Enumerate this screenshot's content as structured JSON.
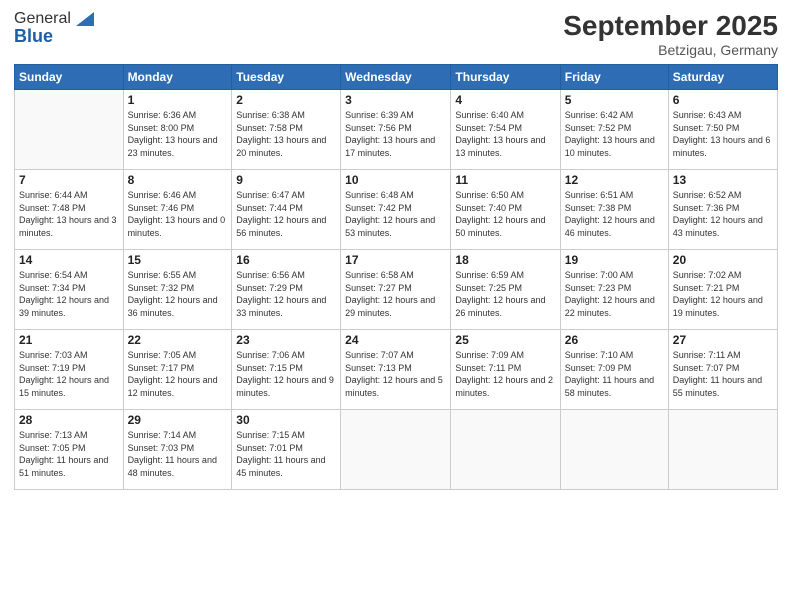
{
  "logo": {
    "general": "General",
    "blue": "Blue"
  },
  "header": {
    "month": "September 2025",
    "location": "Betzigau, Germany"
  },
  "weekdays": [
    "Sunday",
    "Monday",
    "Tuesday",
    "Wednesday",
    "Thursday",
    "Friday",
    "Saturday"
  ],
  "weeks": [
    [
      {
        "day": "",
        "sunrise": "",
        "sunset": "",
        "daylight": ""
      },
      {
        "day": "1",
        "sunrise": "Sunrise: 6:36 AM",
        "sunset": "Sunset: 8:00 PM",
        "daylight": "Daylight: 13 hours and 23 minutes."
      },
      {
        "day": "2",
        "sunrise": "Sunrise: 6:38 AM",
        "sunset": "Sunset: 7:58 PM",
        "daylight": "Daylight: 13 hours and 20 minutes."
      },
      {
        "day": "3",
        "sunrise": "Sunrise: 6:39 AM",
        "sunset": "Sunset: 7:56 PM",
        "daylight": "Daylight: 13 hours and 17 minutes."
      },
      {
        "day": "4",
        "sunrise": "Sunrise: 6:40 AM",
        "sunset": "Sunset: 7:54 PM",
        "daylight": "Daylight: 13 hours and 13 minutes."
      },
      {
        "day": "5",
        "sunrise": "Sunrise: 6:42 AM",
        "sunset": "Sunset: 7:52 PM",
        "daylight": "Daylight: 13 hours and 10 minutes."
      },
      {
        "day": "6",
        "sunrise": "Sunrise: 6:43 AM",
        "sunset": "Sunset: 7:50 PM",
        "daylight": "Daylight: 13 hours and 6 minutes."
      }
    ],
    [
      {
        "day": "7",
        "sunrise": "Sunrise: 6:44 AM",
        "sunset": "Sunset: 7:48 PM",
        "daylight": "Daylight: 13 hours and 3 minutes."
      },
      {
        "day": "8",
        "sunrise": "Sunrise: 6:46 AM",
        "sunset": "Sunset: 7:46 PM",
        "daylight": "Daylight: 13 hours and 0 minutes."
      },
      {
        "day": "9",
        "sunrise": "Sunrise: 6:47 AM",
        "sunset": "Sunset: 7:44 PM",
        "daylight": "Daylight: 12 hours and 56 minutes."
      },
      {
        "day": "10",
        "sunrise": "Sunrise: 6:48 AM",
        "sunset": "Sunset: 7:42 PM",
        "daylight": "Daylight: 12 hours and 53 minutes."
      },
      {
        "day": "11",
        "sunrise": "Sunrise: 6:50 AM",
        "sunset": "Sunset: 7:40 PM",
        "daylight": "Daylight: 12 hours and 50 minutes."
      },
      {
        "day": "12",
        "sunrise": "Sunrise: 6:51 AM",
        "sunset": "Sunset: 7:38 PM",
        "daylight": "Daylight: 12 hours and 46 minutes."
      },
      {
        "day": "13",
        "sunrise": "Sunrise: 6:52 AM",
        "sunset": "Sunset: 7:36 PM",
        "daylight": "Daylight: 12 hours and 43 minutes."
      }
    ],
    [
      {
        "day": "14",
        "sunrise": "Sunrise: 6:54 AM",
        "sunset": "Sunset: 7:34 PM",
        "daylight": "Daylight: 12 hours and 39 minutes."
      },
      {
        "day": "15",
        "sunrise": "Sunrise: 6:55 AM",
        "sunset": "Sunset: 7:32 PM",
        "daylight": "Daylight: 12 hours and 36 minutes."
      },
      {
        "day": "16",
        "sunrise": "Sunrise: 6:56 AM",
        "sunset": "Sunset: 7:29 PM",
        "daylight": "Daylight: 12 hours and 33 minutes."
      },
      {
        "day": "17",
        "sunrise": "Sunrise: 6:58 AM",
        "sunset": "Sunset: 7:27 PM",
        "daylight": "Daylight: 12 hours and 29 minutes."
      },
      {
        "day": "18",
        "sunrise": "Sunrise: 6:59 AM",
        "sunset": "Sunset: 7:25 PM",
        "daylight": "Daylight: 12 hours and 26 minutes."
      },
      {
        "day": "19",
        "sunrise": "Sunrise: 7:00 AM",
        "sunset": "Sunset: 7:23 PM",
        "daylight": "Daylight: 12 hours and 22 minutes."
      },
      {
        "day": "20",
        "sunrise": "Sunrise: 7:02 AM",
        "sunset": "Sunset: 7:21 PM",
        "daylight": "Daylight: 12 hours and 19 minutes."
      }
    ],
    [
      {
        "day": "21",
        "sunrise": "Sunrise: 7:03 AM",
        "sunset": "Sunset: 7:19 PM",
        "daylight": "Daylight: 12 hours and 15 minutes."
      },
      {
        "day": "22",
        "sunrise": "Sunrise: 7:05 AM",
        "sunset": "Sunset: 7:17 PM",
        "daylight": "Daylight: 12 hours and 12 minutes."
      },
      {
        "day": "23",
        "sunrise": "Sunrise: 7:06 AM",
        "sunset": "Sunset: 7:15 PM",
        "daylight": "Daylight: 12 hours and 9 minutes."
      },
      {
        "day": "24",
        "sunrise": "Sunrise: 7:07 AM",
        "sunset": "Sunset: 7:13 PM",
        "daylight": "Daylight: 12 hours and 5 minutes."
      },
      {
        "day": "25",
        "sunrise": "Sunrise: 7:09 AM",
        "sunset": "Sunset: 7:11 PM",
        "daylight": "Daylight: 12 hours and 2 minutes."
      },
      {
        "day": "26",
        "sunrise": "Sunrise: 7:10 AM",
        "sunset": "Sunset: 7:09 PM",
        "daylight": "Daylight: 11 hours and 58 minutes."
      },
      {
        "day": "27",
        "sunrise": "Sunrise: 7:11 AM",
        "sunset": "Sunset: 7:07 PM",
        "daylight": "Daylight: 11 hours and 55 minutes."
      }
    ],
    [
      {
        "day": "28",
        "sunrise": "Sunrise: 7:13 AM",
        "sunset": "Sunset: 7:05 PM",
        "daylight": "Daylight: 11 hours and 51 minutes."
      },
      {
        "day": "29",
        "sunrise": "Sunrise: 7:14 AM",
        "sunset": "Sunset: 7:03 PM",
        "daylight": "Daylight: 11 hours and 48 minutes."
      },
      {
        "day": "30",
        "sunrise": "Sunrise: 7:15 AM",
        "sunset": "Sunset: 7:01 PM",
        "daylight": "Daylight: 11 hours and 45 minutes."
      },
      {
        "day": "",
        "sunrise": "",
        "sunset": "",
        "daylight": ""
      },
      {
        "day": "",
        "sunrise": "",
        "sunset": "",
        "daylight": ""
      },
      {
        "day": "",
        "sunrise": "",
        "sunset": "",
        "daylight": ""
      },
      {
        "day": "",
        "sunrise": "",
        "sunset": "",
        "daylight": ""
      }
    ]
  ]
}
